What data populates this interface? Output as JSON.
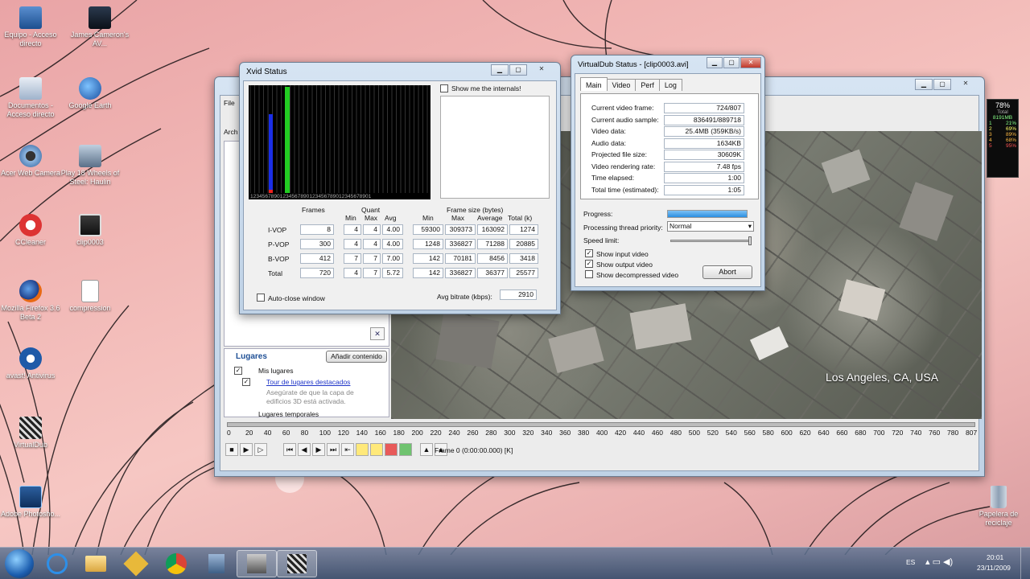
{
  "desktop_icons": [
    {
      "label": "Equipo - Acceso directo"
    },
    {
      "label": "James Cameron's AV..."
    },
    {
      "label": "Documentos - Acceso directo"
    },
    {
      "label": "Google Earth"
    },
    {
      "label": "Acer Web Camera"
    },
    {
      "label": "Play 18 Wheels of Steel: Haulin"
    },
    {
      "label": "CCleaner"
    },
    {
      "label": "clip0003"
    },
    {
      "label": "Mozilla Firefox 3.6 Beta 2"
    },
    {
      "label": "compression"
    },
    {
      "label": "avast! Antivirus"
    },
    {
      "label": "VirtualDub"
    },
    {
      "label": "Adobe Photosho..."
    },
    {
      "label": "Papelera de reciclaje"
    }
  ],
  "main_window": {
    "menu_file": "File",
    "menu_arch": "Arch",
    "lugares_title": "Lugares",
    "add_content": "Añadir contenido",
    "mis_lugares": "Mis lugares",
    "tour": "Tour de lugares destacados",
    "tour_hint": "Asegúrate de que la capa de edificios 3D está activada.",
    "lugares_temporales": "Lugares temporales",
    "map_location": "Los Angeles, CA, USA",
    "timeline_ticks": [
      "0",
      "20",
      "40",
      "60",
      "80",
      "100",
      "120",
      "140",
      "160",
      "180",
      "200",
      "220",
      "240",
      "260",
      "280",
      "300",
      "320",
      "340",
      "360",
      "380",
      "400",
      "420",
      "440",
      "460",
      "480",
      "500",
      "520",
      "540",
      "560",
      "580",
      "600",
      "620",
      "640",
      "660",
      "680",
      "700",
      "720",
      "740",
      "760",
      "780",
      "807"
    ],
    "frame_status": "Frame 0 (0:00:00.000) [K]",
    "cpu_total": "78%",
    "cpu_total_label": "Total",
    "cpu_mem": "8191MB",
    "cpu_rows": [
      {
        "c": "1",
        "v": "21%"
      },
      {
        "c": "2",
        "v": "69%"
      },
      {
        "c": "3",
        "v": "89%"
      },
      {
        "c": "4",
        "v": "68%"
      },
      {
        "c": "5",
        "v": "95%"
      }
    ]
  },
  "xvid": {
    "title": "Xvid Status",
    "show_internals": "Show me the internals!",
    "bar_axis": "12345678901234567890123456789012345678901",
    "h_frames": "Frames",
    "h_quant": "Quant",
    "h_framesize": "Frame size (bytes)",
    "h_min": "Min",
    "h_max": "Max",
    "h_avg": "Avg",
    "h_average": "Average",
    "h_total": "Total (k)",
    "rows": [
      {
        "label": "I-VOP",
        "frames": "8",
        "qmin": "4",
        "qmax": "4",
        "qavg": "4.00",
        "smin": "59300",
        "smax": "309373",
        "savg": "163092",
        "tot": "1274"
      },
      {
        "label": "P-VOP",
        "frames": "300",
        "qmin": "4",
        "qmax": "4",
        "qavg": "4.00",
        "smin": "1248",
        "smax": "336827",
        "savg": "71288",
        "tot": "20885"
      },
      {
        "label": "B-VOP",
        "frames": "412",
        "qmin": "7",
        "qmax": "7",
        "qavg": "7.00",
        "smin": "142",
        "smax": "70181",
        "savg": "8456",
        "tot": "3418"
      },
      {
        "label": "Total",
        "frames": "720",
        "qmin": "4",
        "qmax": "7",
        "qavg": "5.72",
        "smin": "142",
        "smax": "336827",
        "savg": "36377",
        "tot": "25577"
      }
    ],
    "auto_close": "Auto-close window",
    "avg_bitrate_label": "Avg bitrate (kbps):",
    "avg_bitrate": "2910"
  },
  "vdub": {
    "title": "VirtualDub Status - [clip0003.avi]",
    "tabs": [
      "Main",
      "Video",
      "Perf",
      "Log"
    ],
    "stats": [
      {
        "label": "Current video frame:",
        "value": "724/807"
      },
      {
        "label": "Current audio sample:",
        "value": "836491/889718"
      },
      {
        "label": "Video data:",
        "value": "25.4MB (359KB/s)"
      },
      {
        "label": "Audio data:",
        "value": "1634KB"
      },
      {
        "label": "Projected file size:",
        "value": "30609K"
      },
      {
        "label": "Video rendering rate:",
        "value": "7.48 fps"
      },
      {
        "label": "Time elapsed:",
        "value": "1:00"
      },
      {
        "label": "Total time (estimated):",
        "value": "1:05"
      }
    ],
    "progress_label": "Progress:",
    "progress_value": 1.0,
    "priority_label": "Processing thread priority:",
    "priority_value": "Normal",
    "speed_label": "Speed limit:",
    "show_input": "Show input video",
    "show_output": "Show output video",
    "show_decompressed": "Show decompressed video",
    "abort": "Abort"
  },
  "taskbar": {
    "lang": "ES",
    "time": "20:01",
    "date": "23/11/2009"
  }
}
